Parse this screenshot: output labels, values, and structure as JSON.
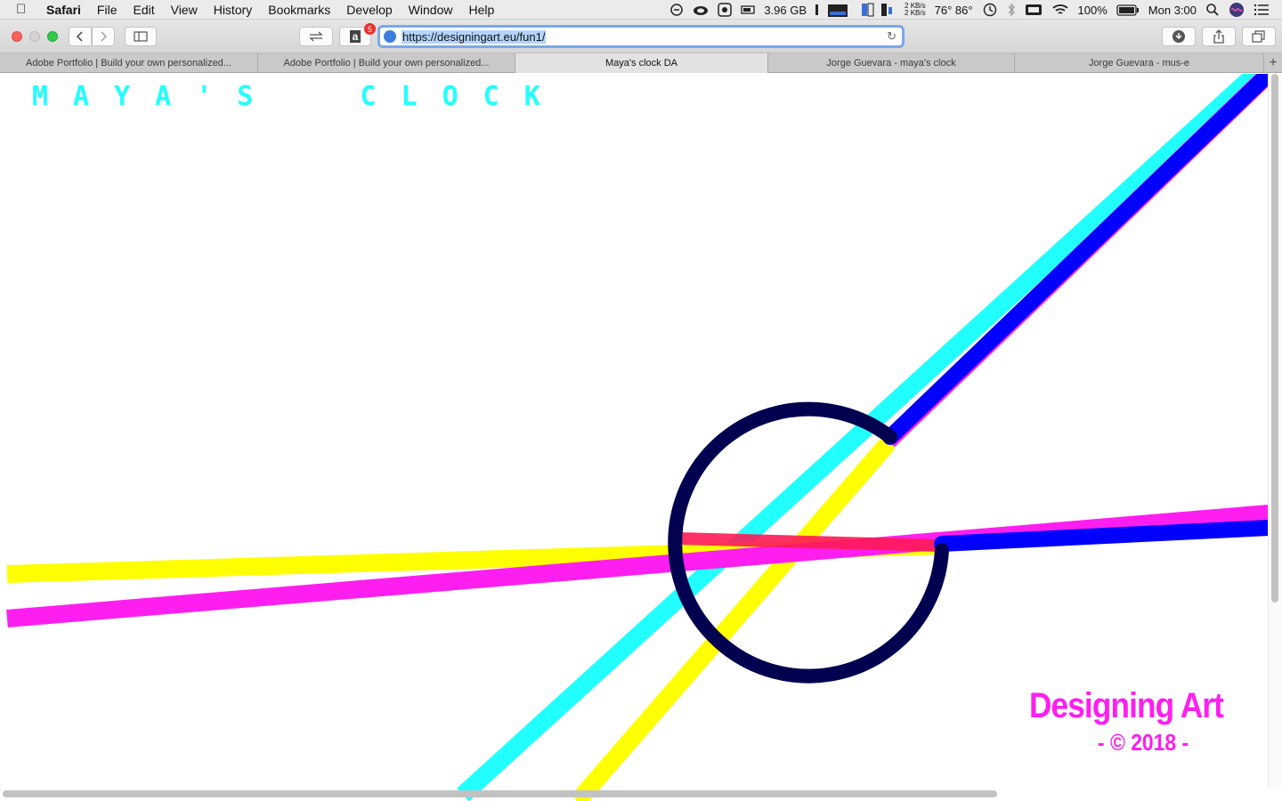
{
  "menubar": {
    "apple_icon": "apple-icon",
    "items": [
      "Safari",
      "File",
      "Edit",
      "View",
      "History",
      "Bookmarks",
      "Develop",
      "Window",
      "Help"
    ],
    "memory": "3.96 GB",
    "net_up": "2 KB/s",
    "net_down": "2 KB/s",
    "temps": "76° 86°",
    "battery": "100%",
    "clock": "Mon 3:00"
  },
  "toolbar": {
    "url": "https://designingart.eu/fun1/",
    "amazon_label": "a",
    "amazon_badge": "5"
  },
  "tabs": [
    {
      "label": "Adobe Portfolio | Build your own personalized..."
    },
    {
      "label": "Adobe Portfolio | Build your own personalized..."
    },
    {
      "label": "Maya's clock DA"
    },
    {
      "label": "Jorge Guevara - maya's clock"
    },
    {
      "label": "Jorge Guevara - mus-e"
    }
  ],
  "page": {
    "title": "MAYA'S  CLOCK",
    "brand": "Designing Art",
    "copyright": "- © 2018 -"
  },
  "colors": {
    "cyan": "#22ffff",
    "magenta": "#ff1ef0",
    "yellow": "#ffff00",
    "blue": "#0000ff",
    "navy": "#000050"
  }
}
